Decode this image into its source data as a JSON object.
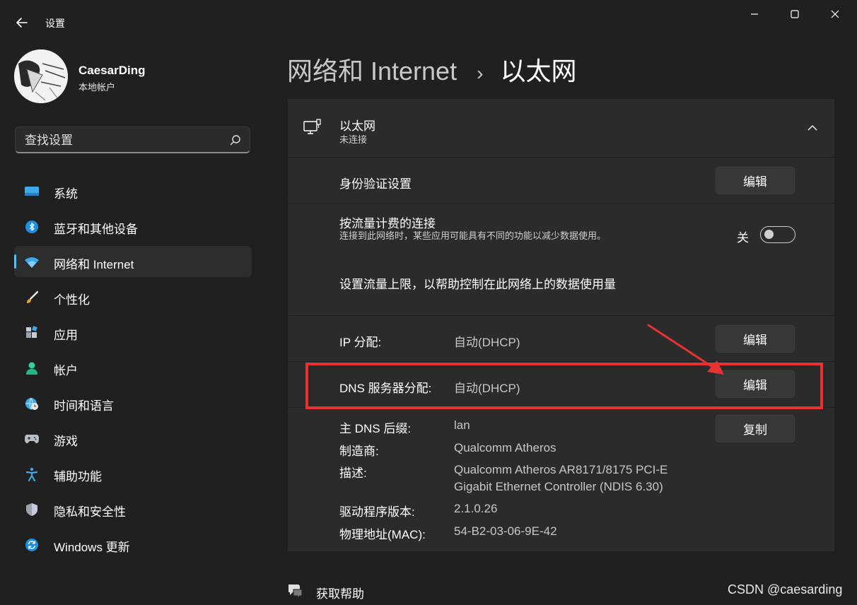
{
  "window": {
    "app_title": "设置",
    "controls": {
      "minimize": "—",
      "maximize": "☐",
      "close": "✕"
    }
  },
  "user": {
    "name": "CaesarDing",
    "account_type": "本地帐户"
  },
  "search": {
    "placeholder": "查找设置"
  },
  "sidebar": {
    "items": [
      {
        "label": "系统",
        "icon": "system-icon"
      },
      {
        "label": "蓝牙和其他设备",
        "icon": "bluetooth-icon"
      },
      {
        "label": "网络和 Internet",
        "icon": "wifi-icon",
        "selected": true
      },
      {
        "label": "个性化",
        "icon": "brush-icon"
      },
      {
        "label": "应用",
        "icon": "apps-icon"
      },
      {
        "label": "帐户",
        "icon": "person-icon"
      },
      {
        "label": "时间和语言",
        "icon": "globe-clock-icon"
      },
      {
        "label": "游戏",
        "icon": "gamepad-icon"
      },
      {
        "label": "辅助功能",
        "icon": "accessibility-icon"
      },
      {
        "label": "隐私和安全性",
        "icon": "shield-icon"
      },
      {
        "label": "Windows 更新",
        "icon": "update-icon"
      }
    ]
  },
  "breadcrumb": {
    "parent": "网络和 Internet",
    "separator": "›",
    "current": "以太网"
  },
  "ethernet": {
    "title": "以太网",
    "status": "未连接",
    "auth": {
      "label": "身份验证设置",
      "button": "编辑"
    },
    "metered": {
      "label": "按流量计费的连接",
      "description": "连接到此网络时，某些应用可能具有不同的功能以减少数据使用。",
      "state_label": "关",
      "on": false
    },
    "data_limit_link": "设置流量上限，以帮助控制在此网络上的数据使用量",
    "ip": {
      "label": "IP 分配:",
      "value": "自动(DHCP)",
      "button": "编辑"
    },
    "dns": {
      "label": "DNS 服务器分配:",
      "value": "自动(DHCP)",
      "button": "编辑"
    },
    "properties": {
      "copy_button": "复制",
      "dns_suffix_label": "主 DNS 后缀:",
      "dns_suffix_value": "lan",
      "manufacturer_label": "制造商:",
      "manufacturer_value": "Qualcomm Atheros",
      "description_label": "描述:",
      "description_value_line1": "Qualcomm Atheros AR8171/8175 PCI-E",
      "description_value_line2": "Gigabit Ethernet Controller (NDIS 6.30)",
      "driver_label": "驱动程序版本:",
      "driver_value": "2.1.0.26",
      "mac_label": "物理地址(MAC):",
      "mac_value": "54-B2-03-06-9E-42"
    }
  },
  "help": {
    "label": "获取帮助"
  },
  "watermark": "CSDN @caesarding",
  "colors": {
    "accent": "#4cc2ff",
    "annotation_red": "#e83232",
    "background": "#202020",
    "card": "#2b2b2b"
  }
}
